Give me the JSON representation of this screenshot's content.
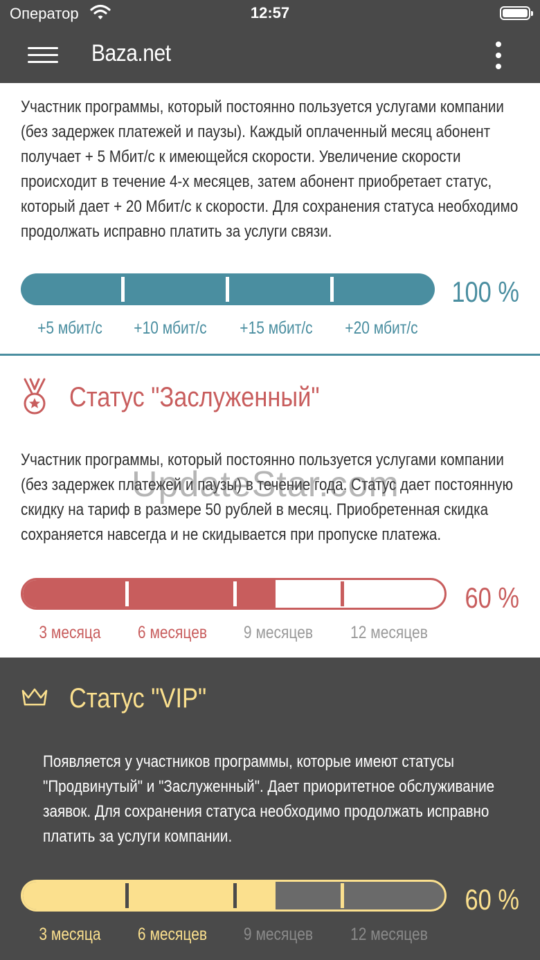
{
  "status_bar": {
    "carrier": "Оператор",
    "time": "12:57"
  },
  "header": {
    "title": "Baza.net"
  },
  "advanced": {
    "description": "Участник программы, который постоянно пользуется услугами компании (без задержек платежей и паузы). Каждый оплаченный месяц абонент получает + 5 Мбит/с к имеющейся скорости. Увеличение скорости происходит в течение 4-х месяцев, затем абонент приобретает статус, который дает + 20 Мбит/с к скорости. Для сохранения статуса необходимо продолжать исправно платить за услуги связи.",
    "progress": {
      "value": 1.0,
      "label": "100 %"
    },
    "milestones": [
      "+5 мбит/с",
      "+10 мбит/с",
      "+15 мбит/с",
      "+20 мбит/с"
    ],
    "color": "#4a8ea0"
  },
  "honored": {
    "title": "Статус \"Заслуженный\"",
    "icon": "medal-icon",
    "description": "Участник программы, который постоянно пользуется услугами компании (без задержек платежей и паузы) в течение года. Статус дает постоянную скидку на тариф в размере 50 рублей в месяц. Приобретенная скидка сохраняется навсегда и не скидывается при пропуске платежа.",
    "progress": {
      "value": 0.6,
      "label": "60 %"
    },
    "milestones": [
      "3 месяца",
      "6 месяцев",
      "9 месяцев",
      "12 месяцев"
    ],
    "color": "#c85d5d"
  },
  "vip": {
    "title": "Статус \"VIP\"",
    "icon": "crown-icon",
    "description": "Появляется у участников программы, которые имеют статусы \"Продвинутый\" и \"Заслуженный\". Дает приоритетное обслуживание заявок. Для сохранения статуса необходимо продолжать исправно платить за услуги компании.",
    "progress": {
      "value": 0.6,
      "label": "60 %"
    },
    "milestones": [
      "3 месяца",
      "6 месяцев",
      "9 месяцев",
      "12 месяцев"
    ],
    "color": "#fbe08e"
  },
  "watermark": "UpdateStar.com"
}
